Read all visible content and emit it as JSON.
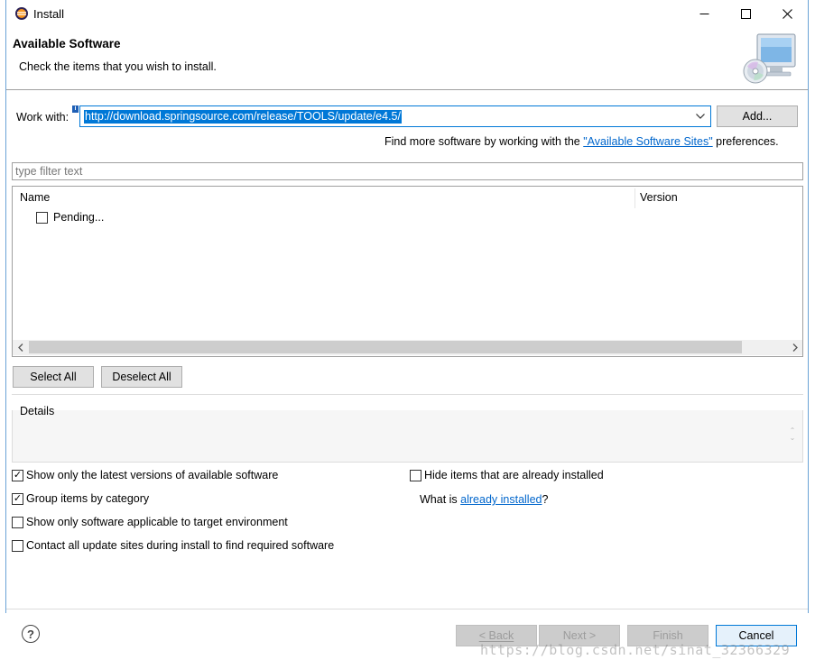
{
  "window": {
    "title": "Install"
  },
  "banner": {
    "title": "Available Software",
    "subtitle": "Check the items that you wish to install."
  },
  "workwith": {
    "label": "Work with:",
    "value": "http://download.springsource.com/release/TOOLS/update/e4.5/",
    "add_label": "Add..."
  },
  "findmore": {
    "prefix": "Find more software by working with the ",
    "link": "\"Available Software Sites\"",
    "suffix": " preferences."
  },
  "filter": {
    "placeholder": "type filter text"
  },
  "table": {
    "columns": [
      "Name",
      "Version"
    ],
    "rows": [
      {
        "name": "Pending...",
        "checked": false
      }
    ]
  },
  "buttons": {
    "select_all": "Select All",
    "deselect_all": "Deselect All",
    "back": "< Back",
    "next": "Next >",
    "finish": "Finish",
    "cancel": "Cancel"
  },
  "details": {
    "label": "Details"
  },
  "options": {
    "latest_versions": {
      "label": "Show only the latest versions of available software",
      "checked": true
    },
    "group_by_category": {
      "label": "Group items by category",
      "checked": true
    },
    "target_env": {
      "label": "Show only software applicable to target environment",
      "checked": false
    },
    "contact_sites": {
      "label": "Contact all update sites during install to find required software",
      "checked": false
    },
    "hide_installed": {
      "label": "Hide items that are already installed",
      "checked": false
    }
  },
  "whatis": {
    "prefix": "What is ",
    "link": "already installed",
    "suffix": "?"
  },
  "watermark": "https://blog.csdn.net/sinat_32366329",
  "colors": {
    "accent": "#0078d7",
    "link": "#0066cc",
    "frame": "#6aa3d6"
  },
  "icons": {
    "app": "eclipse-icon",
    "help": "help-icon",
    "banner": "install-monitor-cd-icon"
  }
}
